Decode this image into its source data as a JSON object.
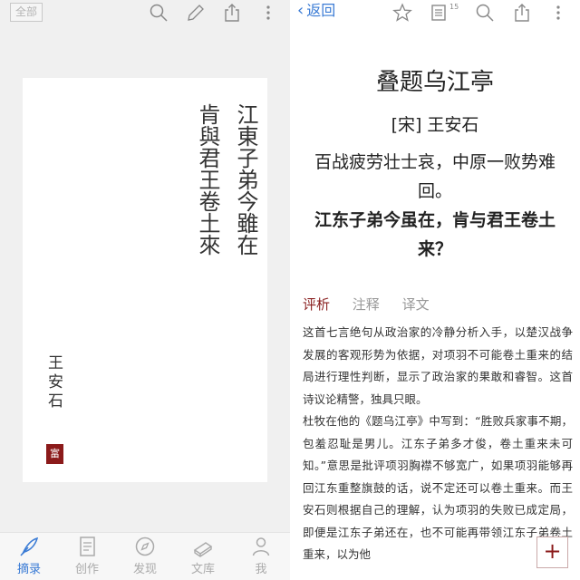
{
  "left": {
    "all_label": "全部",
    "poem_vertical": {
      "column1": "江東子弟今雖在",
      "column2": "肯與君王卷土來"
    },
    "author": "王安石",
    "seal": "富"
  },
  "bottom_nav": [
    {
      "label": "摘录",
      "icon": "quill-icon",
      "active": true
    },
    {
      "label": "创作",
      "icon": "notebook-icon",
      "active": false
    },
    {
      "label": "发现",
      "icon": "compass-icon",
      "active": false
    },
    {
      "label": "文库",
      "icon": "books-icon",
      "active": false
    },
    {
      "label": "我",
      "icon": "person-icon",
      "active": false
    }
  ],
  "right": {
    "back_label": "返回",
    "count_badge": "15",
    "title": "叠题乌江亭",
    "author": "[宋] 王安石",
    "poem_line1": "百战疲劳壮士哀，中原一败势难回。",
    "poem_line2": "江东子弟今虽在，肯与君王卷土来？",
    "tabs": [
      "评析",
      "注释",
      "译文"
    ],
    "paragraph1": "这首七言绝句从政治家的冷静分析入手，以楚汉战争发展的客观形势为依据，对项羽不可能卷土重来的结局进行理性判断，显示了政治家的果敢和睿智。这首诗议论精警，独具只眼。",
    "paragraph2": "杜牧在他的《题乌江亭》中写到：“胜败兵家事不期，包羞忍耻是男儿。江东子弟多才俊，卷土重来未可知。”意思是批评项羽胸襟不够宽广，如果项羽能够再回江东重整旗鼓的话，说不定还可以卷土重来。而王安石则根据自己的理解，认为项羽的失败已成定局，即便是江东子弟还在，也不可能再带领江东子弟卷土重来，以为他",
    "fab_label": "+"
  },
  "colors": {
    "accent_blue": "#3a7bd5",
    "accent_red": "#8b1a1a",
    "tab_active": "#8b2222"
  }
}
